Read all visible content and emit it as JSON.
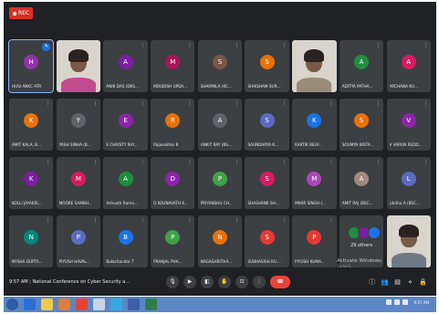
{
  "recording": {
    "label": "REC"
  },
  "participants": [
    {
      "name": "HUSI ANKC ATR",
      "initial": "H",
      "color": "#9334a8",
      "type": "avatar",
      "self": true
    },
    {
      "name": "",
      "type": "video",
      "shirt": "#c24b8f"
    },
    {
      "name": "ANIK DAS (DKS...",
      "initial": "A",
      "color": "#7b1fa2",
      "type": "avatar"
    },
    {
      "name": "MOUDISH UPDA...",
      "initial": "M",
      "color": "#ad1457",
      "type": "avatar"
    },
    {
      "name": "SHARMILA (KC...",
      "initial": "S",
      "color": "#795548",
      "type": "avatar"
    },
    {
      "name": "SHIKSHAM SUR...",
      "initial": "S",
      "color": "#e8710a",
      "type": "avatar"
    },
    {
      "name": "",
      "type": "video",
      "shirt": "#9a8c7a"
    },
    {
      "name": "ADITYA PATHA...",
      "initial": "A",
      "color": "#1e8e3e",
      "type": "avatar"
    },
    {
      "name": "ARCHANA KU...",
      "initial": "A",
      "color": "#d81b60",
      "type": "avatar"
    },
    {
      "name": "AMIT KALA, B...",
      "initial": "K",
      "color": "#e8710a",
      "type": "avatar"
    },
    {
      "name": "YASH SINHA (B...",
      "initial": "Y",
      "color": "#5f6368",
      "type": "avatar"
    },
    {
      "name": "E CHRISTY RAY...",
      "initial": "E",
      "color": "#8e24aa",
      "type": "avatar"
    },
    {
      "name": "Rajasekhar B",
      "initial": "R",
      "color": "#e8710a",
      "type": "avatar"
    },
    {
      "name": "ANKIT RAY (BS...",
      "initial": "A",
      "color": "#5f6368",
      "type": "avatar"
    },
    {
      "name": "SAUNDARYA K...",
      "initial": "S",
      "color": "#5c6bc0",
      "type": "avatar"
    },
    {
      "name": "KARTIK BELP...",
      "initial": "K",
      "color": "#1a73e8",
      "type": "avatar"
    },
    {
      "name": "SOUMYA BISTA...",
      "initial": "S",
      "color": "#e8710a",
      "type": "avatar"
    },
    {
      "name": "V VARUN REDD...",
      "initial": "V",
      "color": "#8e24aa",
      "type": "avatar"
    },
    {
      "name": "KOLLI JAYAKRI...",
      "initial": "K",
      "color": "#7b1fa2",
      "type": "avatar"
    },
    {
      "name": "MOORE SAMBH...",
      "initial": "M",
      "color": "#d81b60",
      "type": "avatar"
    },
    {
      "name": "Ashvath Rama...",
      "initial": "A",
      "color": "#1e8e3e",
      "type": "avatar"
    },
    {
      "name": "D KOUNAVATH K...",
      "initial": "D",
      "color": "#8e24aa",
      "type": "avatar"
    },
    {
      "name": "PRIYANSHU CH...",
      "initial": "P",
      "color": "#43a047",
      "type": "avatar"
    },
    {
      "name": "SHASHANK SH...",
      "initial": "S",
      "color": "#d81b60",
      "type": "avatar"
    },
    {
      "name": "MIHIR SINGH (...",
      "initial": "M",
      "color": "#ab47bc",
      "type": "avatar"
    },
    {
      "name": "AMIT RAJ (BSC...",
      "initial": "A",
      "color": "#a1887f",
      "type": "avatar"
    },
    {
      "name": "Likitha A (BSC...",
      "initial": "L",
      "color": "#5c6bc0",
      "type": "avatar"
    },
    {
      "name": "NYSHA GUPTA...",
      "initial": "N",
      "color": "#00897b",
      "type": "avatar"
    },
    {
      "name": "PIYUSH HAVAL...",
      "initial": "P",
      "color": "#5c6bc0",
      "type": "avatar"
    },
    {
      "name": "Balachandar T",
      "initial": "B",
      "color": "#1a73e8",
      "type": "avatar"
    },
    {
      "name": "PRANJAL PHA...",
      "initial": "P",
      "color": "#43a047",
      "type": "avatar"
    },
    {
      "name": "NAGASHRITHA...",
      "initial": "N",
      "color": "#e8710a",
      "type": "avatar"
    },
    {
      "name": "SUBHASISH KU...",
      "initial": "S",
      "color": "#e53935",
      "type": "avatar"
    },
    {
      "name": "PIYUSH KUMA...",
      "initial": "P",
      "color": "#e53935",
      "type": "avatar"
    },
    {
      "name": "",
      "type": "others",
      "label": "29 others"
    },
    {
      "name": "",
      "type": "video",
      "shirt": "#6f7a86"
    }
  ],
  "bottom_bar": {
    "time": "9:57 AM",
    "separator": "|",
    "meeting_title": "National Conference on Cyber Security a..."
  },
  "activation": {
    "line1": "Activate Windows",
    "line2": "Go to S..."
  }
}
